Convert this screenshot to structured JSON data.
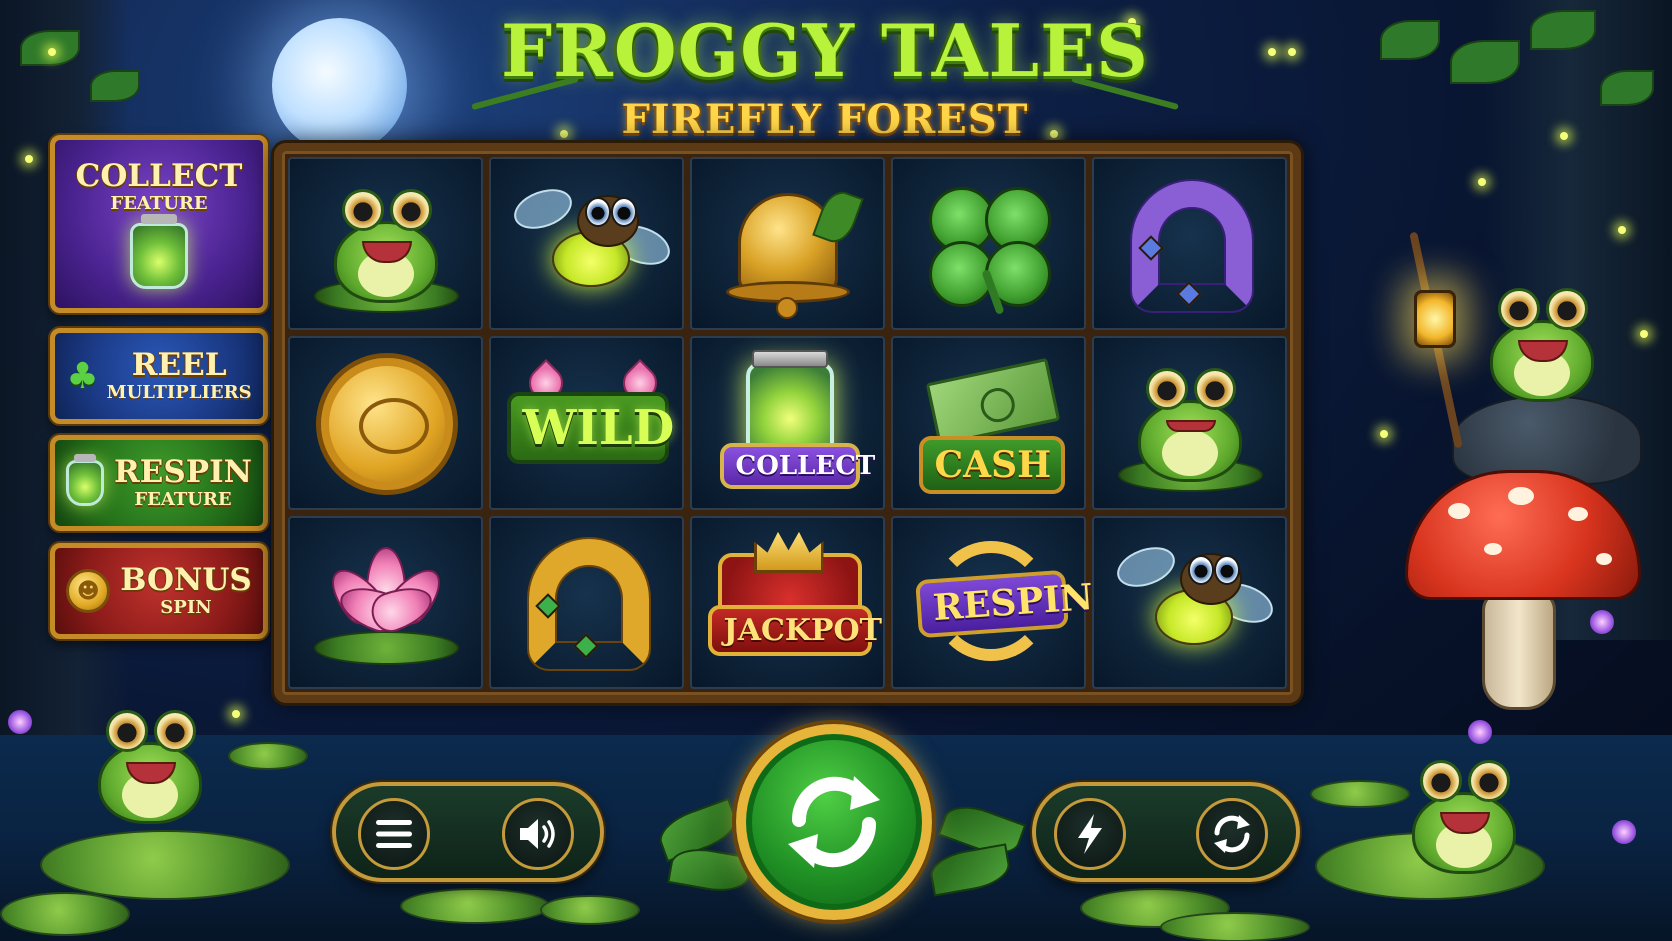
{
  "title": {
    "main": "FROGGY TALES",
    "sub": "FIREFLY FOREST"
  },
  "features": [
    {
      "line1": "COLLECT",
      "line2": "FEATURE",
      "icon": "firefly-jar-icon",
      "color": "#4a2390"
    },
    {
      "line1": "REEL",
      "line2": "MULTIPLIERS",
      "icon": "clover-icon",
      "color": "#1b3a86"
    },
    {
      "line1": "RESPIN",
      "line2": "FEATURE",
      "icon": "firefly-jar-icon",
      "color": "#24701a"
    },
    {
      "line1": "BONUS",
      "line2": "SPIN",
      "icon": "coin-icon",
      "color": "#8e1c1a"
    }
  ],
  "reels": {
    "rows": [
      [
        "frog",
        "firefly",
        "bell",
        "clover",
        "purple-horseshoe"
      ],
      [
        "frog-coin",
        "wild",
        "collect-jar",
        "cash",
        "frog"
      ],
      [
        "lotus",
        "gold-horseshoe",
        "jackpot",
        "respin",
        "firefly"
      ]
    ],
    "labels": {
      "wild": "WILD",
      "collect": "COLLECT",
      "cash": "CASH",
      "jackpot": "JACKPOT",
      "respin": "RESPIN"
    }
  },
  "controls": {
    "menu_icon": "menu-icon",
    "sound_icon": "sound-icon",
    "spin_icon": "spin-arrows-icon",
    "turbo_icon": "lightning-icon",
    "autoplay_icon": "autoplay-icon"
  },
  "colors": {
    "accent_gold": "#e7b53a",
    "spin_green": "#1f8f24",
    "title_green": "#b8f23a",
    "title_gold": "#ffd64a"
  }
}
